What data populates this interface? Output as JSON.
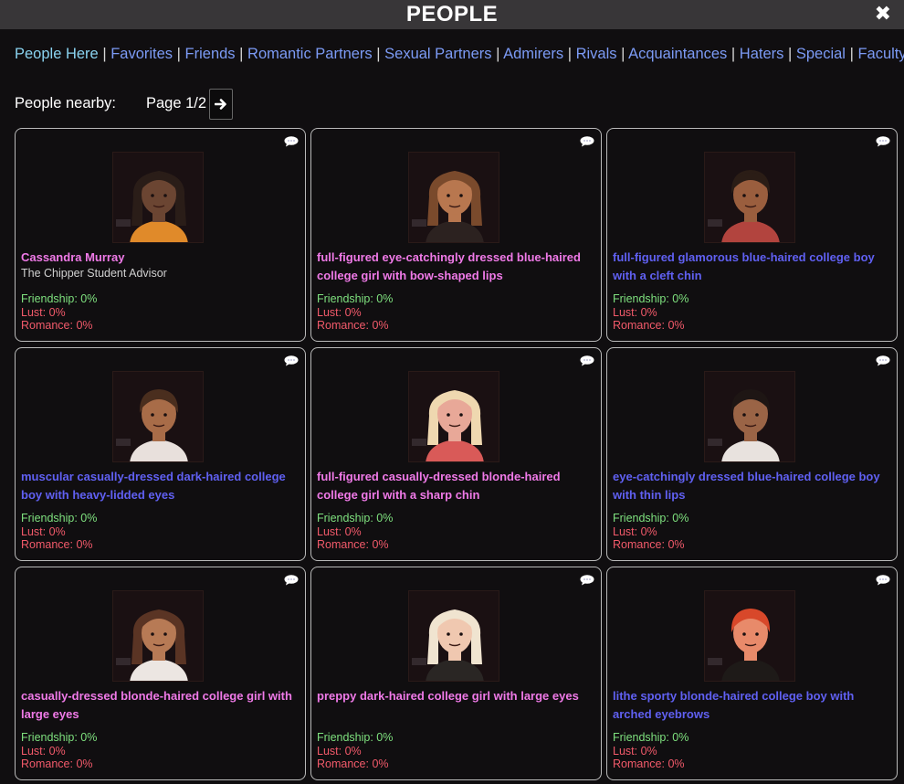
{
  "window": {
    "title": "PEOPLE",
    "close_icon": "close-icon"
  },
  "tabs": [
    {
      "label": "People Here",
      "active": true
    },
    {
      "label": "Favorites"
    },
    {
      "label": "Friends"
    },
    {
      "label": "Romantic Partners"
    },
    {
      "label": "Sexual Partners"
    },
    {
      "label": "Admirers"
    },
    {
      "label": "Rivals"
    },
    {
      "label": "Acquaintances"
    },
    {
      "label": "Haters"
    },
    {
      "label": "Special"
    },
    {
      "label": "Faculty"
    }
  ],
  "nearby": {
    "label": "People nearby:",
    "page_text": "Page 1/2",
    "next_icon": "arrow-right-icon"
  },
  "people": [
    {
      "name": "Cassandra Murray",
      "subtitle": "The Chipper Student Advisor",
      "gender": "girl",
      "skin": "#6b4532",
      "hair": "#2a1d18",
      "shirt": "#e08a2a",
      "friendship": "Friendship: 0%",
      "lust": "Lust: 0%",
      "romance": "Romance: 0%"
    },
    {
      "name": "full-figured eye-catchingly dressed blue-haired college girl with bow-shaped lips",
      "gender": "girl",
      "skin": "#b8774f",
      "hair": "#7a4a2c",
      "shirt": "#2c2220",
      "friendship": "Friendship: 0%",
      "lust": "Lust: 0%",
      "romance": "Romance: 0%"
    },
    {
      "name": "full-figured glamorous blue-haired college boy with a cleft chin",
      "gender": "boy",
      "skin": "#9a5e3e",
      "hair": "#2b1d16",
      "shirt": "#b2443e",
      "friendship": "Friendship: 0%",
      "lust": "Lust: 0%",
      "romance": "Romance: 0%"
    },
    {
      "name": "muscular casually-dressed dark-haired college boy with heavy-lidded eyes",
      "gender": "boy",
      "skin": "#a86c48",
      "hair": "#4a2e1e",
      "shirt": "#e8e0dc",
      "friendship": "Friendship: 0%",
      "lust": "Lust: 0%",
      "romance": "Romance: 0%"
    },
    {
      "name": "full-figured casually-dressed blonde-haired college girl with a sharp chin",
      "gender": "girl",
      "skin": "#e8a898",
      "hair": "#efd8b0",
      "shirt": "#d95a58",
      "friendship": "Friendship: 0%",
      "lust": "Lust: 0%",
      "romance": "Romance: 0%"
    },
    {
      "name": "eye-catchingly dressed blue-haired college boy with thin lips",
      "gender": "boy",
      "skin": "#9a6446",
      "hair": "#1e1614",
      "shirt": "#e8e2de",
      "friendship": "Friendship: 0%",
      "lust": "Lust: 0%",
      "romance": "Romance: 0%"
    },
    {
      "name": "casually-dressed blonde-haired college girl with large eyes",
      "gender": "girl",
      "skin": "#b77a55",
      "hair": "#5a3424",
      "shirt": "#ece6e2",
      "friendship": "Friendship: 0%",
      "lust": "Lust: 0%",
      "romance": "Romance: 0%"
    },
    {
      "name": "preppy dark-haired college girl with large eyes",
      "gender": "girl",
      "skin": "#f0c8b0",
      "hair": "#f0e4d0",
      "shirt": "#2a2624",
      "friendship": "Friendship: 0%",
      "lust": "Lust: 0%",
      "romance": "Romance: 0%"
    },
    {
      "name": "lithe sporty blonde-haired college boy with arched eyebrows",
      "gender": "boy",
      "skin": "#e88a6a",
      "hair": "#d8482a",
      "shirt": "#1e1a18",
      "friendship": "Friendship: 0%",
      "lust": "Lust: 0%",
      "romance": "Romance: 0%"
    }
  ],
  "colors": {
    "girl_name": "#f07ae8",
    "boy_name": "#6060f2",
    "friendship": "#7ee07e",
    "lust_romance": "#f25a6a",
    "tab_link": "#7c9bf5",
    "tab_active": "#8ad3f0"
  }
}
